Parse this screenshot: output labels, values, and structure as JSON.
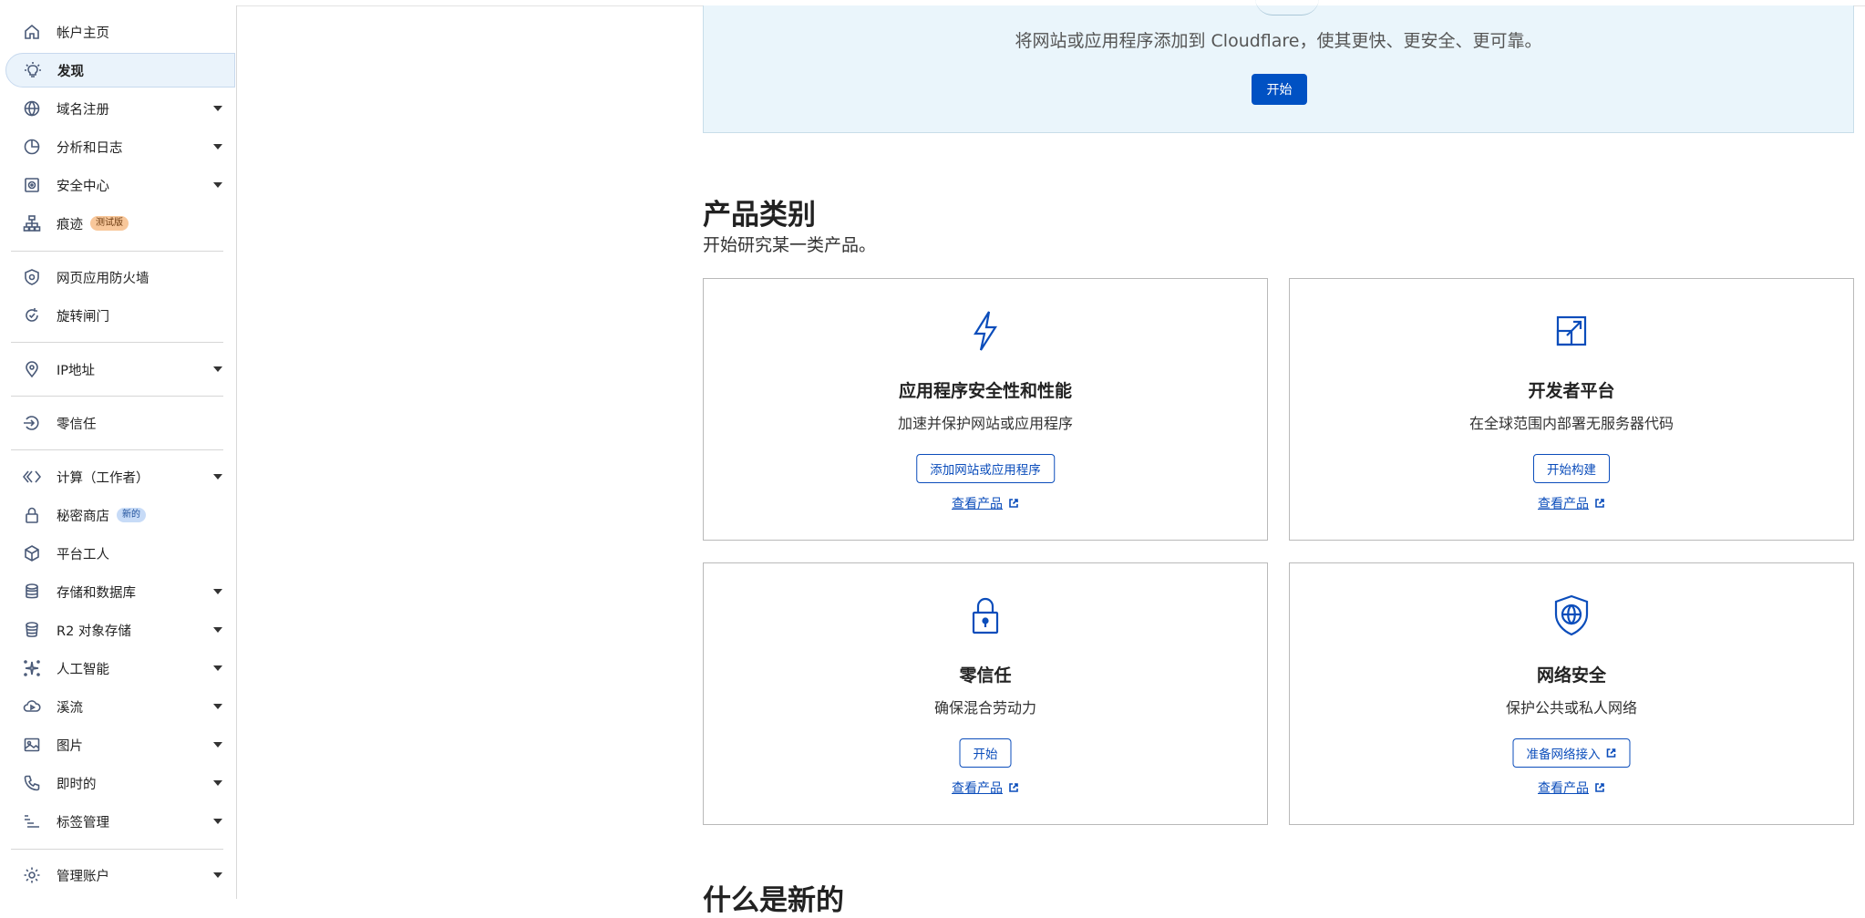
{
  "sidebar": {
    "items": [
      {
        "label": "帐户主页",
        "icon": "home-icon",
        "caret": false
      },
      {
        "label": "发现",
        "icon": "lightbulb-icon",
        "caret": false,
        "active": true
      },
      {
        "label": "域名注册",
        "icon": "globe-icon",
        "caret": true
      },
      {
        "label": "分析和日志",
        "icon": "pie-chart-icon",
        "caret": true
      },
      {
        "label": "安全中心",
        "icon": "security-center-icon",
        "caret": true
      },
      {
        "label": "痕迹",
        "icon": "sitemap-icon",
        "caret": false,
        "badge": "测试版"
      },
      {
        "label": "网页应用防火墙",
        "icon": "shield-icon",
        "caret": false
      },
      {
        "label": "旋转闸门",
        "icon": "refresh-icon",
        "caret": false
      },
      {
        "label": "IP地址",
        "icon": "location-pin-icon",
        "caret": true
      },
      {
        "label": "零信任",
        "icon": "zero-trust-icon",
        "caret": false
      },
      {
        "label": "计算（工作者）",
        "icon": "workers-icon",
        "caret": true
      },
      {
        "label": "秘密商店",
        "icon": "lock-icon",
        "caret": false,
        "badge": "新的"
      },
      {
        "label": "平台工人",
        "icon": "cube-icon",
        "caret": false
      },
      {
        "label": "存储和数据库",
        "icon": "database-icon",
        "caret": true
      },
      {
        "label": "R2 对象存储",
        "icon": "bucket-icon",
        "caret": true
      },
      {
        "label": "人工智能",
        "icon": "ai-sparkle-icon",
        "caret": true
      },
      {
        "label": "溪流",
        "icon": "cloud-play-icon",
        "caret": true
      },
      {
        "label": "图片",
        "icon": "image-icon",
        "caret": true
      },
      {
        "label": "即时的",
        "icon": "phone-icon",
        "caret": true
      },
      {
        "label": "标签管理",
        "icon": "tag-list-icon",
        "caret": true
      },
      {
        "label": "管理账户",
        "icon": "gear-icon",
        "caret": true
      }
    ]
  },
  "hero": {
    "text": "将网站或应用程序添加到 Cloudflare，使其更快、更安全、更可靠。",
    "button": "开始"
  },
  "categories": {
    "title": "产品类别",
    "subtitle": "开始研究某一类产品。",
    "cards": [
      {
        "icon": "lightning-icon",
        "title": "应用程序安全性和性能",
        "desc": "加速并保护网站或应用程序",
        "button": "添加网站或应用程序",
        "link": "查看产品"
      },
      {
        "icon": "developer-platform-icon",
        "title": "开发者平台",
        "desc": "在全球范围内部署无服务器代码",
        "button": "开始构建",
        "link": "查看产品"
      },
      {
        "icon": "padlock-icon",
        "title": "零信任",
        "desc": "确保混合劳动力",
        "button": "开始",
        "link": "查看产品"
      },
      {
        "icon": "globe-shield-icon",
        "title": "网络安全",
        "desc": "保护公共或私人网络",
        "button": "准备网络接入",
        "link": "查看产品"
      }
    ]
  },
  "whats_new": {
    "title": "什么是新的"
  }
}
